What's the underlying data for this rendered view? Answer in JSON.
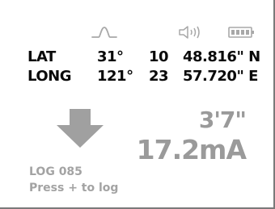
{
  "status_bar": {
    "icons": [
      "pulse-icon",
      "speaker-icon",
      "battery-icon"
    ],
    "icon_color": "#a8a8a8"
  },
  "coordinates": {
    "lat": {
      "label": "LAT",
      "deg": "31°",
      "min": "10",
      "sec": "48.816\" N"
    },
    "long": {
      "label": "LONG",
      "deg": "121°",
      "min": "23",
      "sec": "57.720\" E"
    }
  },
  "direction": {
    "icon": "down-arrow-icon",
    "color": "#a0a0a0"
  },
  "readings": {
    "depth": "3'7\"",
    "current": "17.2mA"
  },
  "log": {
    "count_label": "LOG 085",
    "hint": "Press + to log"
  },
  "colors": {
    "text_primary": "#0a0a0a",
    "text_muted": "#9a9a9a"
  }
}
